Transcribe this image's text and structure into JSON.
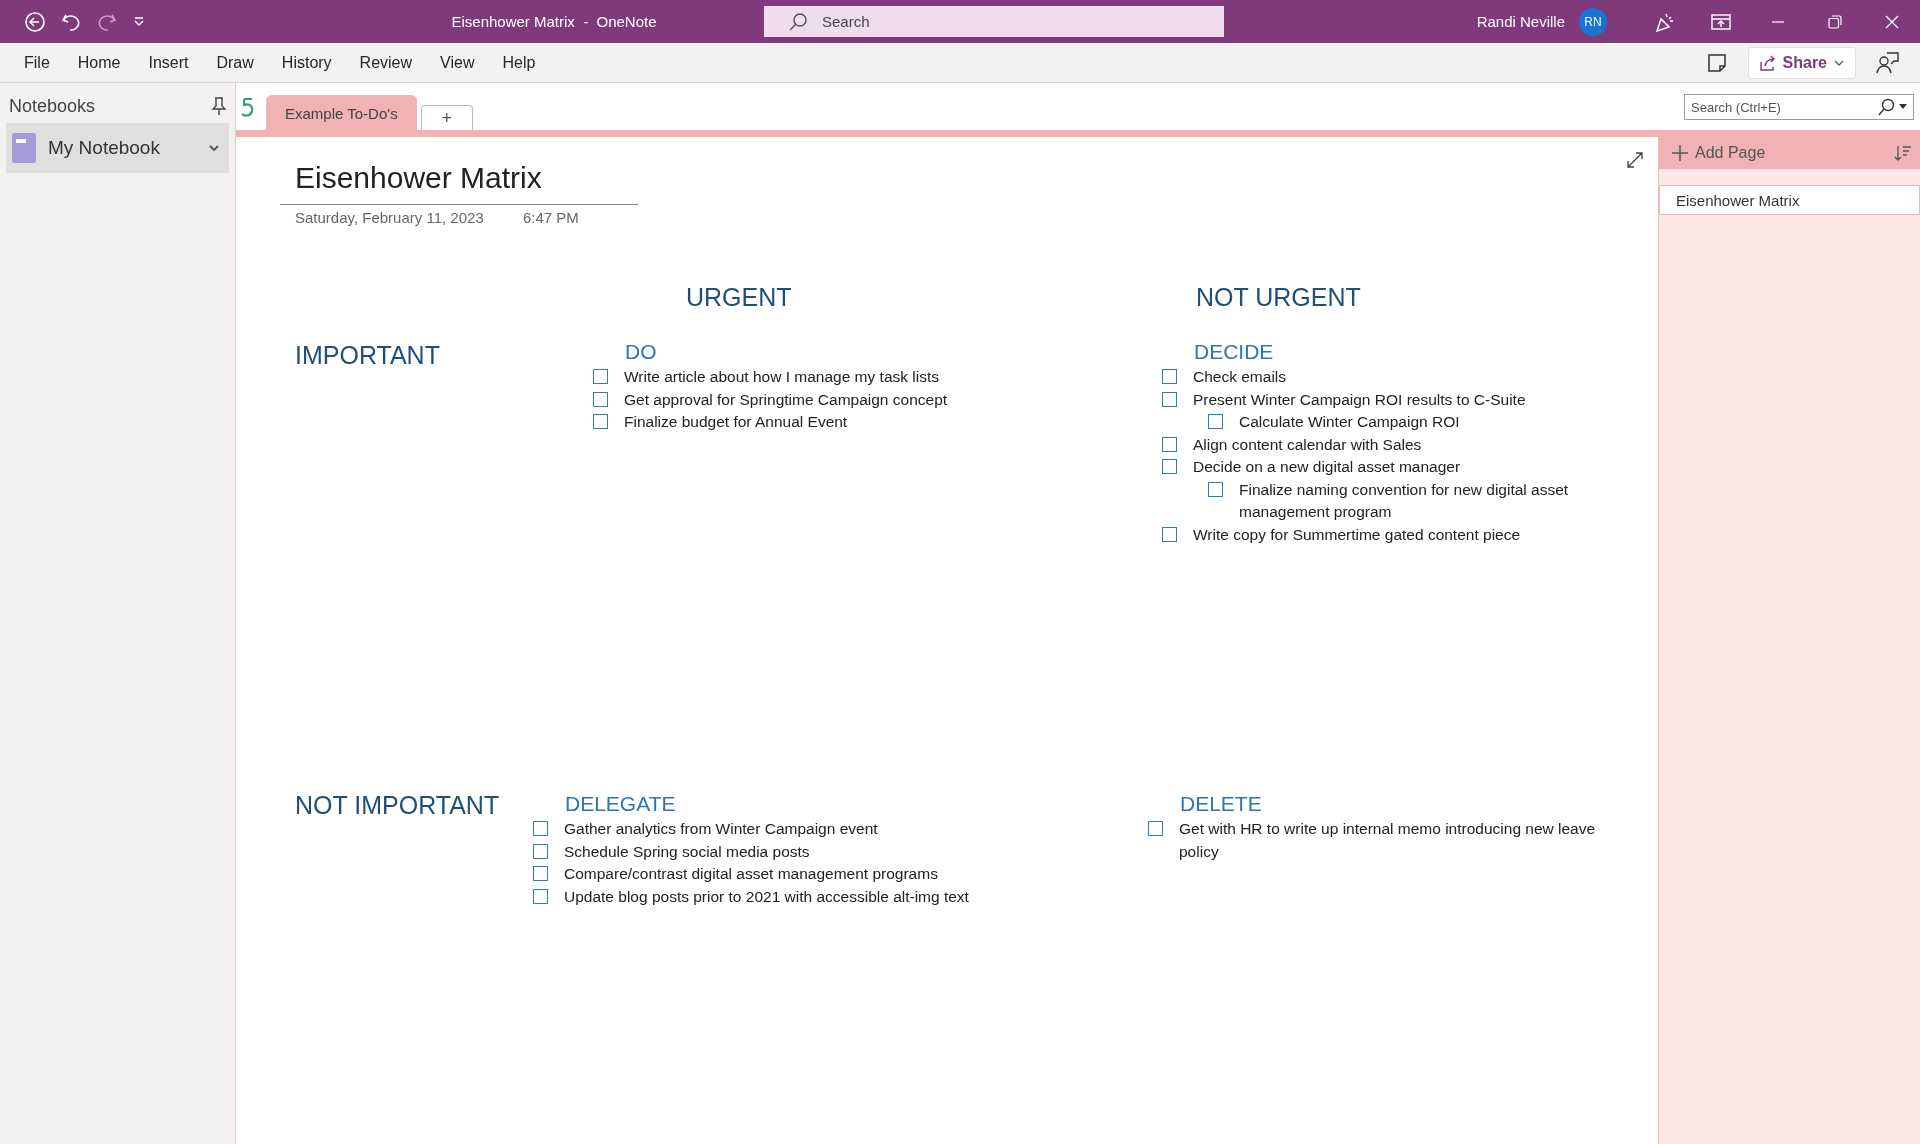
{
  "title_bar": {
    "title": "Eisenhower Matrix  -  OneNote",
    "search_placeholder": "Search",
    "user_name": "Randi Neville",
    "user_initials": "RN"
  },
  "menu": [
    "File",
    "Home",
    "Insert",
    "Draw",
    "History",
    "Review",
    "View",
    "Help"
  ],
  "share_button": "Share",
  "sidebar": {
    "heading": "Notebooks",
    "notebooks": [
      {
        "name": "My Notebook",
        "selected": true
      }
    ]
  },
  "section_tabs": [
    {
      "label": "Example To-Do's",
      "selected": true
    }
  ],
  "add_section": "+",
  "pages_pane": {
    "search_placeholder": "Search (Ctrl+E)",
    "add_page": "Add Page",
    "pages": [
      {
        "title": "Eisenhower Matrix",
        "selected": true
      }
    ]
  },
  "page": {
    "title": "Eisenhower Matrix",
    "date": "Saturday, February 11, 2023",
    "time": "6:47 PM",
    "column_headings": [
      "URGENT",
      "NOT URGENT"
    ],
    "row_headings": [
      "IMPORTANT",
      "NOT IMPORTANT"
    ],
    "quadrants": [
      {
        "heading": "DO",
        "tasks": [
          {
            "text": "Write article about how I manage my task lists",
            "checked": false
          },
          {
            "text": "Get approval for Springtime Campaign concept",
            "checked": false
          },
          {
            "text": "Finalize budget for Annual Event",
            "checked": false
          }
        ]
      },
      {
        "heading": "DECIDE",
        "tasks": [
          {
            "text": "Check emails",
            "checked": false
          },
          {
            "text": "Present Winter Campaign ROI results to C-Suite",
            "checked": false,
            "children": [
              {
                "text": "Calculate Winter Campaign ROI",
                "checked": false
              }
            ]
          },
          {
            "text": "Align content calendar with Sales",
            "checked": false
          },
          {
            "text": "Decide on a new digital asset manager",
            "checked": false,
            "children": [
              {
                "text": "Finalize naming convention for new digital asset management program",
                "checked": false
              }
            ]
          },
          {
            "text": "Write copy for Summertime gated content piece",
            "checked": false
          }
        ]
      },
      {
        "heading": "DELEGATE",
        "tasks": [
          {
            "text": "Gather analytics from Winter Campaign event",
            "checked": false
          },
          {
            "text": "Schedule Spring social media posts",
            "checked": false
          },
          {
            "text": "Compare/contrast digital asset management programs",
            "checked": false
          },
          {
            "text": "Update blog posts prior to 2021 with accessible alt-img text",
            "checked": false
          }
        ]
      },
      {
        "heading": "DELETE",
        "tasks": [
          {
            "text": "Get with HR to write up internal memo introducing new leave policy",
            "checked": false
          }
        ]
      }
    ]
  }
}
